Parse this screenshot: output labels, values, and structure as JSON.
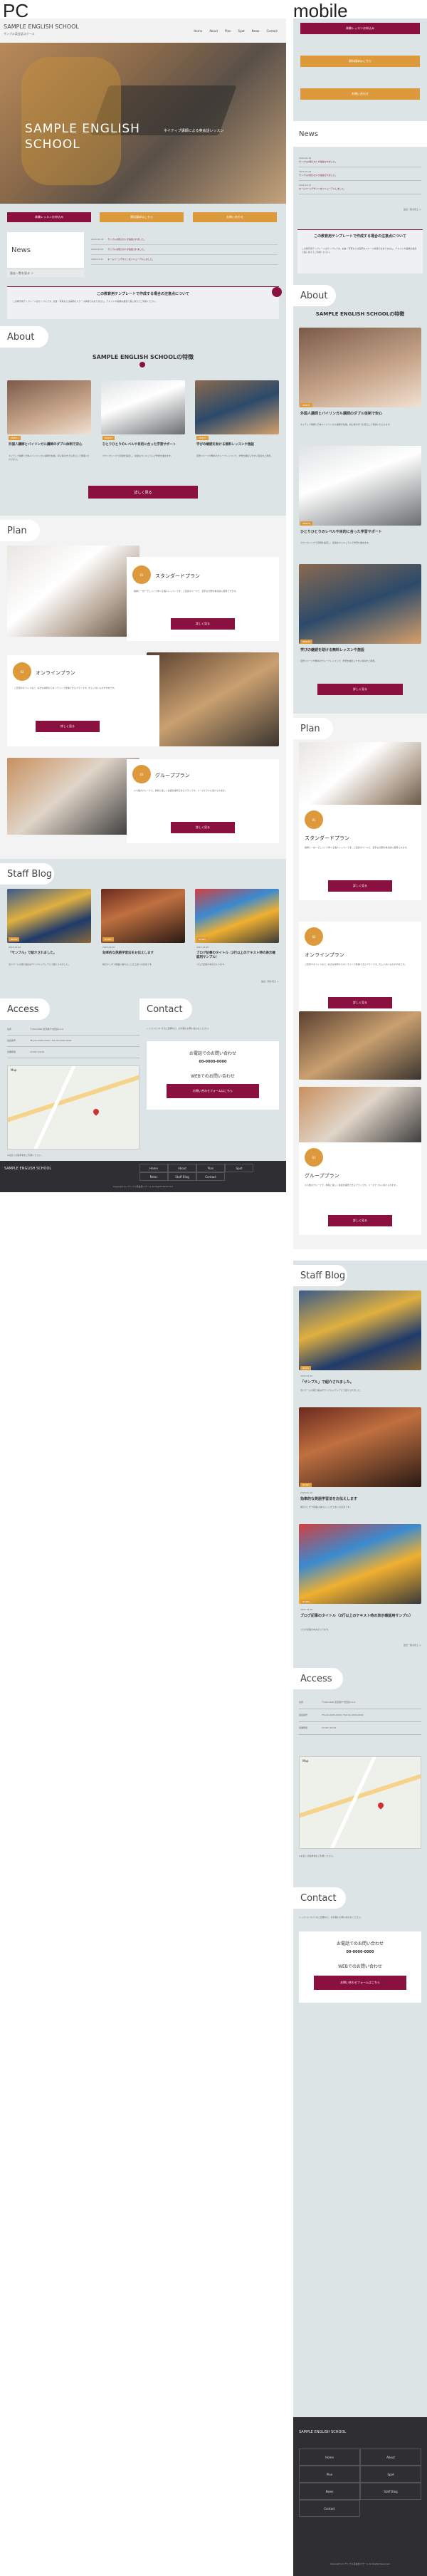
{
  "labels": {
    "pc": "PC",
    "mobile": "mobile"
  },
  "site": {
    "name": "SAMPLE ENGLISH SCHOOL",
    "sub": "サンプル英会話スクール",
    "hero_title": "SAMPLE ENGLISH SCHOOL",
    "hero_tagline": "ネイティブ講師による英会話レッスン",
    "nav": [
      "Home",
      "About",
      "Plan",
      "Spot",
      "News",
      "Contact"
    ],
    "cta": [
      "体験レッスンお申込み",
      "資料請求はこちら",
      "お問い合わせ"
    ],
    "news": {
      "title": "News",
      "more": "過去一覧を見る ＞",
      "items": [
        {
          "date": "2023.01.16",
          "text": "サンプルお知らせ1 が追加されました。"
        },
        {
          "date": "2023.01.03",
          "text": "サンプルお知らせ2 が追加されました。"
        },
        {
          "date": "2022.12.27",
          "text": "ホームページデザインをリニューアルしました。"
        }
      ]
    },
    "notice": {
      "title": "この教育用テンプレートで作成する場合の注意点について",
      "body": "この教育用テンプレートはサンプルです。文章・写真などは実際のスクール情報ではありません。テキストや画像は各自で差し替えてご利用ください。"
    },
    "about": {
      "title": "About",
      "heading": "SAMPLE ENGLISH SCHOOLの特徴",
      "items": [
        {
          "tag": "POINT1",
          "title": "外国人講師とバイリンガル講師のダブル体制で安心",
          "text": "ネイティブ講師と日本人バイリンガル講師が在籍。初心者の方でも安心して受講いただけます。"
        },
        {
          "tag": "POINT2",
          "title": "ひとりひとりのレベルや目的に合った学習サポート",
          "text": "カウンセリングで目標を設定し、最適なカリキュラムで学習を進めます。"
        },
        {
          "tag": "POINT3",
          "title": "学びの継続を助ける無料レッスンや施設",
          "text": "自習スペースや無料のグループレッスンで、学習を継続しやすい環境をご用意。"
        }
      ],
      "button": "詳しく見る"
    },
    "plan": {
      "title": "Plan",
      "items": [
        {
          "num": "01",
          "title": "スタンダードプラン",
          "text": "講師と一対一でじっくり学べる個人レッスンです。ご自身のペースで、苦手な分野を重点的に練習できます。",
          "button": "詳しく見る"
        },
        {
          "num": "02",
          "title": "オンラインプラン",
          "text": "ご自宅やオフィスなど、好きな場所からオンラインで受講できるプランです。忙しい方にもおすすめです。",
          "button": "詳しく見る"
        },
        {
          "num": "03",
          "title": "グループプラン",
          "text": "少人数のグループで、仲間と楽しく会話を練習できるプランです。リーズナブルに続けられます。",
          "button": "詳しく見る"
        }
      ]
    },
    "blog": {
      "title": "Staff Blog",
      "more": "過去一覧を見る ＞",
      "items": [
        {
          "tag": "NEWS",
          "date": "2023.01.20",
          "title": "「サンプル」で紹介されました。",
          "text": "当スクールの取り組みがサンプルメディアにて紹介されました。"
        },
        {
          "tag": "STUDY",
          "date": "2023.01.10",
          "title": "効率的な英語学習法をお伝えします",
          "text": "毎日少しずつ英語に触れることが上達への近道です。"
        },
        {
          "tag": "STUDY",
          "date": "2022.12.28",
          "title": "ブログ記事のタイトル（2行以上のテキスト時の表示確認用サンプル）",
          "text": "ブログ記事の本文が入ります。"
        }
      ]
    },
    "access": {
      "title": "Access",
      "rows": [
        {
          "k": "住所",
          "v": "〒000-0000 東京都千代田区0-0-0"
        },
        {
          "k": "電話番号",
          "v": "TEL:00-0000-0000 / FAX:00-0000-0000"
        },
        {
          "k": "営業時間",
          "v": "10:00〜19:00"
        }
      ],
      "notes": "※お近くの駐車場をご利用ください。",
      "map_label": "Map"
    },
    "contact": {
      "title": "Contact",
      "lead": "レッスンについてのご質問など、お気軽にお問い合わせください。",
      "tel_label": "お電話でのお問い合わせ",
      "tel": "00-0000-0000",
      "web_label": "WEBでのお問い合わせ",
      "web_button": "お問い合わせフォームはこちら"
    },
    "footer": {
      "name": "SAMPLE ENGLISH SCHOOL",
      "links": [
        "Home",
        "About",
        "Plan",
        "Spot",
        "News",
        "Staff Blog",
        "Contact"
      ],
      "copy": "Copyright (C) サンプル英会話スクール All Rights Reserved."
    }
  }
}
